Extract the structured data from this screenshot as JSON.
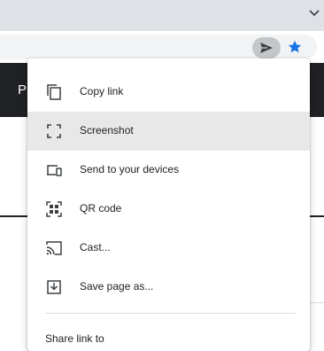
{
  "browser": {
    "colors": {
      "accent": "#1a73e8",
      "tabstrip": "#dee1e6",
      "omnibox": "#f1f3f4"
    },
    "tab_strip_chevron": "chevron-down-icon",
    "toolbar": {
      "share_icon": "send-icon",
      "bookmark_icon": "star-icon"
    }
  },
  "page": {
    "header_text": "P"
  },
  "share_menu": {
    "items": [
      {
        "label": "Copy link",
        "icon": "copy-icon"
      },
      {
        "label": "Screenshot",
        "icon": "screenshot-icon",
        "highlighted": true
      },
      {
        "label": "Send to your devices",
        "icon": "devices-icon"
      },
      {
        "label": "QR code",
        "icon": "qr-code-icon"
      },
      {
        "label": "Cast...",
        "icon": "cast-icon"
      },
      {
        "label": "Save page as...",
        "icon": "save-page-icon"
      }
    ],
    "footer_label": "Share link to"
  }
}
